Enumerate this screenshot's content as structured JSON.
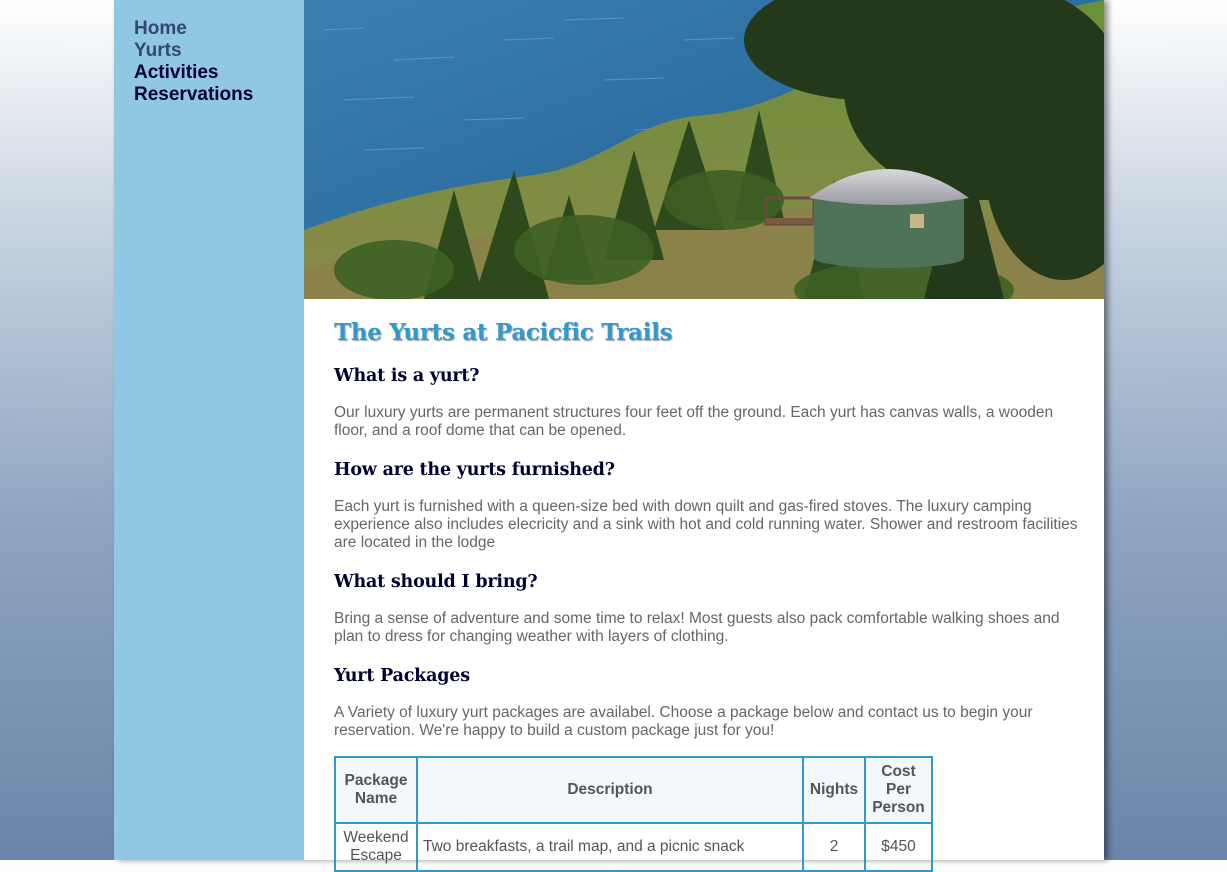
{
  "nav": {
    "items": [
      {
        "label": "Home"
      },
      {
        "label": "Yurts"
      },
      {
        "label": "Activities"
      },
      {
        "label": "Reservations"
      }
    ]
  },
  "main": {
    "title": "The Yurts at Pacicfic Trails",
    "sections": [
      {
        "heading": "What is a yurt?",
        "text": "Our luxury yurts are permanent structures four feet off the ground. Each yurt has canvas walls, a wooden floor, and a roof dome that can be opened."
      },
      {
        "heading": "How are the yurts furnished?",
        "text": "Each yurt is furnished with a queen-size bed with down quilt and gas-fired stoves. The luxury camping experience also includes elecricity and a sink with hot and cold running water. Shower and restroom facilities are located in the lodge"
      },
      {
        "heading": "What should I bring?",
        "text": "Bring a sense of adventure and some time to relax! Most guests also pack comfortable walking shoes and plan to dress for changing weather with layers of clothing."
      },
      {
        "heading": "Yurt Packages",
        "text": "A Variety of luxury yurt packages are availabel. Choose a package below and contact us to begin your reservation. We're happy to build a custom package just for you!"
      }
    ],
    "table": {
      "headers": [
        "Package Name",
        "Description",
        "Nights",
        "Cost Per Person"
      ],
      "rows": [
        {
          "name": "Weekend Escape",
          "description": "Two breakfasts, a trail map, and a picnic snack",
          "nights": "2",
          "cost": "$450"
        }
      ]
    }
  },
  "colors": {
    "sidebar": "#90c7e3",
    "heading_accent": "#3399cc",
    "heading_dark": "#000033",
    "body_text": "#666666"
  }
}
